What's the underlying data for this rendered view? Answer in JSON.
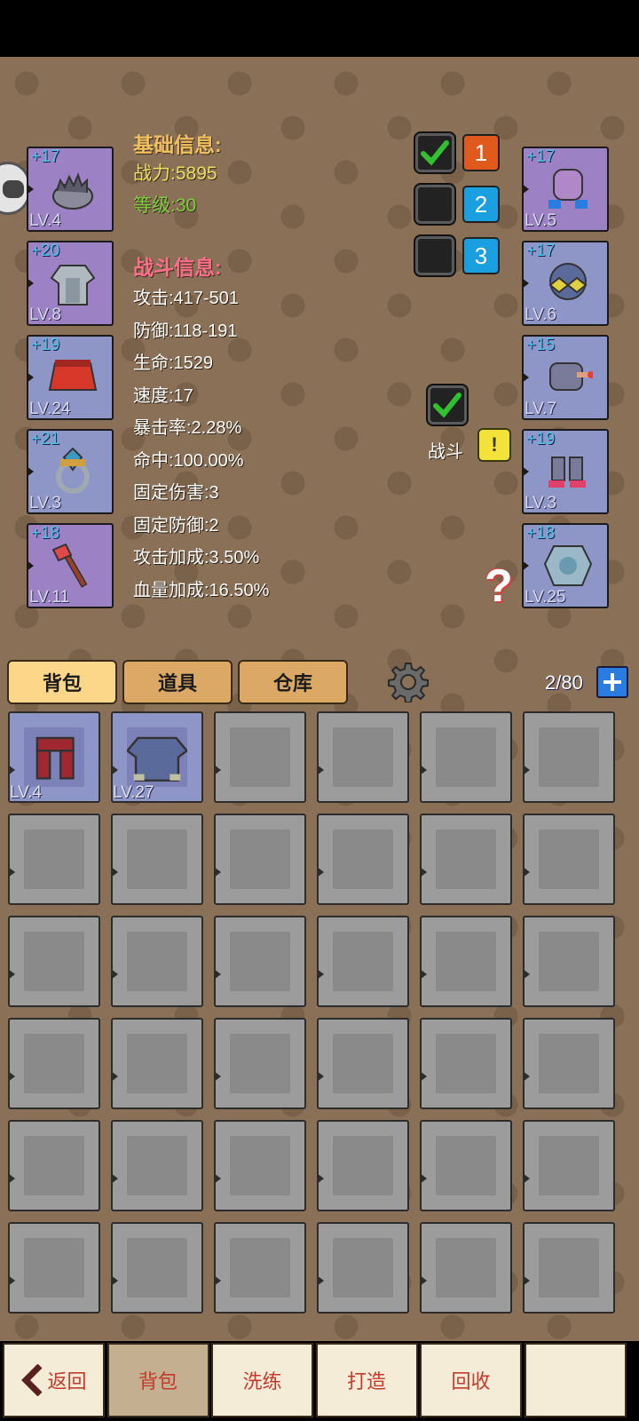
{
  "equipment_left": [
    {
      "plus": "+17",
      "level": "LV.4",
      "item": "helmet",
      "rarity": "purple"
    },
    {
      "plus": "+20",
      "level": "LV.8",
      "item": "armor",
      "rarity": "purple"
    },
    {
      "plus": "+19",
      "level": "LV.24",
      "item": "skirt",
      "rarity": "blue"
    },
    {
      "plus": "+21",
      "level": "LV.3",
      "item": "ring",
      "rarity": "blue"
    },
    {
      "plus": "+18",
      "level": "LV.11",
      "item": "axe-weapon",
      "rarity": "purple"
    }
  ],
  "equipment_right": [
    {
      "plus": "+17",
      "level": "LV.5",
      "item": "gloves",
      "rarity": "purple"
    },
    {
      "plus": "+17",
      "level": "LV.6",
      "item": "goggles",
      "rarity": "blue"
    },
    {
      "plus": "+15",
      "level": "LV.7",
      "item": "pet",
      "rarity": "blue"
    },
    {
      "plus": "+19",
      "level": "LV.3",
      "item": "boots",
      "rarity": "blue"
    },
    {
      "plus": "+18",
      "level": "LV.25",
      "item": "gem-charm",
      "rarity": "blue"
    }
  ],
  "basic_info": {
    "title": "基础信息:",
    "power": "战力:5895",
    "level": "等级:30"
  },
  "battle_info": {
    "title": "战斗信息:",
    "stats": [
      "攻击:417-501",
      "防御:118-191",
      "生命:1529",
      "速度:17",
      "暴击率:2.28%",
      "命中:100.00%",
      "固定伤害:3",
      "固定防御:2",
      "攻击加成:3.50%",
      "血量加成:16.50%"
    ]
  },
  "presets": [
    {
      "checked": true,
      "number": "1",
      "color": "#e05a1e"
    },
    {
      "checked": false,
      "number": "2",
      "color": "#1aa0e0"
    },
    {
      "checked": false,
      "number": "3",
      "color": "#1aa0e0"
    }
  ],
  "battle_toggle": {
    "checked": true,
    "label": "战斗",
    "alert": "!"
  },
  "help_symbol": "?",
  "tabs": [
    {
      "label": "背包",
      "active": true
    },
    {
      "label": "道具",
      "active": false
    },
    {
      "label": "仓库",
      "active": false
    }
  ],
  "capacity": "2/80",
  "inventory": [
    {
      "level": "LV.4",
      "item": "pants"
    },
    {
      "level": "LV.27",
      "item": "shirt"
    }
  ],
  "bottom_nav": [
    {
      "label": "返回",
      "icon": "back-arrow-icon",
      "active": false
    },
    {
      "label": "背包",
      "active": true
    },
    {
      "label": "洗练",
      "active": false
    },
    {
      "label": "打造",
      "active": false
    },
    {
      "label": "回收",
      "active": false
    },
    {
      "label": "",
      "active": false
    }
  ],
  "colors": {
    "background": "#8a7057",
    "basic_title": "#f0c060",
    "power": "#e8e060",
    "level": "#7ccc40",
    "battle_title": "#ff6e8a",
    "check": "#30c030"
  }
}
